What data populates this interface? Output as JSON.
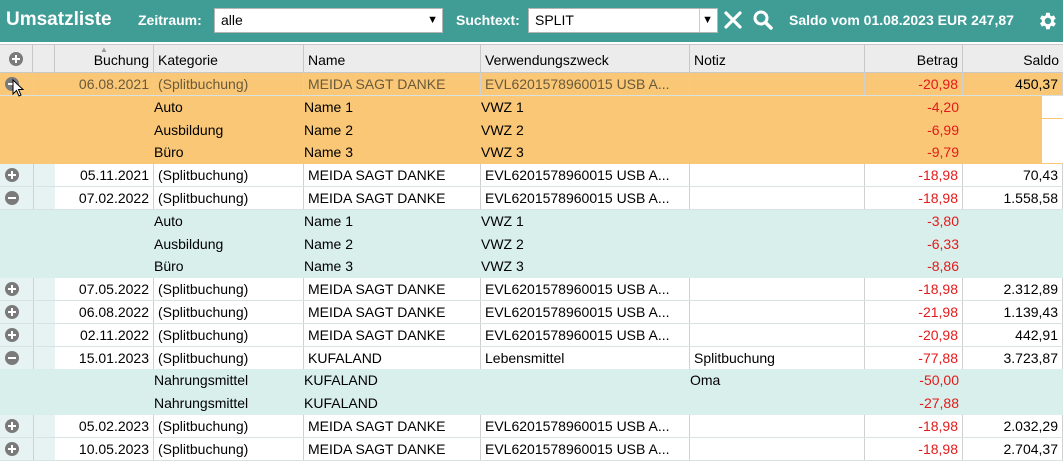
{
  "toolbar": {
    "title": "Umsatzliste",
    "zeitraum_label": "Zeitraum:",
    "zeitraum_value": "alle",
    "suchtext_label": "Suchtext:",
    "suchtext_value": "SPLIT",
    "saldo_text": "Saldo vom 01.08.2023 EUR 247,87",
    "icons": [
      "plus-circle-icon",
      "close-icon",
      "search-icon",
      "gear-icon"
    ]
  },
  "columns": {
    "buchung": "Buchung",
    "kategorie": "Kategorie",
    "name": "Name",
    "verwendungszweck": "Verwendungszweck",
    "notiz": "Notiz",
    "betrag": "Betrag",
    "saldo": "Saldo"
  },
  "colors": {
    "toolbar_bg": "#3f9d96",
    "selected_bg": "#f9c776",
    "row_bg": "#e6f3f2",
    "sub_bg": "#d9efec",
    "negative": "#e21a1a"
  },
  "rows": [
    {
      "kind": "main",
      "expanded": true,
      "selected": true,
      "date": "06.08.2021",
      "kategorie": "(Splitbuchung)",
      "name": "MEIDA SAGT DANKE",
      "vwz": "EVL6201578960015 USB A...",
      "notiz": "",
      "betrag": "-20,98",
      "saldo": "450,37"
    },
    {
      "kind": "sub",
      "selected": true,
      "kategorie": "Auto",
      "name": "Name 1",
      "vwz": "VWZ 1",
      "notiz": "",
      "betrag": "-4,20"
    },
    {
      "kind": "sub",
      "selected": true,
      "kategorie": "Ausbildung",
      "name": "Name 2",
      "vwz": "VWZ 2",
      "notiz": "",
      "betrag": "-6,99"
    },
    {
      "kind": "sub",
      "selected": true,
      "kategorie": "Büro",
      "name": "Name 3",
      "vwz": "VWZ 3",
      "notiz": "",
      "betrag": "-9,79"
    },
    {
      "kind": "main",
      "expanded": false,
      "date": "05.11.2021",
      "kategorie": "(Splitbuchung)",
      "name": "MEIDA SAGT DANKE",
      "vwz": "EVL6201578960015 USB A...",
      "notiz": "",
      "betrag": "-18,98",
      "saldo": "70,43"
    },
    {
      "kind": "main",
      "expanded": true,
      "date": "07.02.2022",
      "kategorie": "(Splitbuchung)",
      "name": "MEIDA SAGT DANKE",
      "vwz": "EVL6201578960015 USB A...",
      "notiz": "",
      "betrag": "-18,98",
      "saldo": "1.558,58"
    },
    {
      "kind": "sub",
      "kategorie": "Auto",
      "name": "Name 1",
      "vwz": "VWZ 1",
      "notiz": "",
      "betrag": "-3,80"
    },
    {
      "kind": "sub",
      "kategorie": "Ausbildung",
      "name": "Name 2",
      "vwz": "VWZ 2",
      "notiz": "",
      "betrag": "-6,33"
    },
    {
      "kind": "sub",
      "kategorie": "Büro",
      "name": "Name 3",
      "vwz": "VWZ 3",
      "notiz": "",
      "betrag": "-8,86"
    },
    {
      "kind": "main",
      "expanded": false,
      "date": "07.05.2022",
      "kategorie": "(Splitbuchung)",
      "name": "MEIDA SAGT DANKE",
      "vwz": "EVL6201578960015 USB A...",
      "notiz": "",
      "betrag": "-18,98",
      "saldo": "2.312,89"
    },
    {
      "kind": "main",
      "expanded": false,
      "date": "06.08.2022",
      "kategorie": "(Splitbuchung)",
      "name": "MEIDA SAGT DANKE",
      "vwz": "EVL6201578960015 USB A...",
      "notiz": "",
      "betrag": "-21,98",
      "saldo": "1.139,43"
    },
    {
      "kind": "main",
      "expanded": false,
      "date": "02.11.2022",
      "kategorie": "(Splitbuchung)",
      "name": "MEIDA SAGT DANKE",
      "vwz": "EVL6201578960015 USB A...",
      "notiz": "",
      "betrag": "-20,98",
      "saldo": "442,91"
    },
    {
      "kind": "main",
      "expanded": true,
      "date": "15.01.2023",
      "kategorie": "(Splitbuchung)",
      "name": "KUFALAND",
      "vwz": "Lebensmittel",
      "notiz": "Splitbuchung",
      "betrag": "-77,88",
      "saldo": "3.723,87"
    },
    {
      "kind": "sub",
      "kategorie": "Nahrungsmittel",
      "name": "KUFALAND",
      "vwz": "",
      "notiz": "Oma",
      "betrag": "-50,00"
    },
    {
      "kind": "sub",
      "kategorie": "Nahrungsmittel",
      "name": "KUFALAND",
      "vwz": "",
      "notiz": "",
      "betrag": "-27,88"
    },
    {
      "kind": "main",
      "expanded": false,
      "date": "05.02.2023",
      "kategorie": "(Splitbuchung)",
      "name": "MEIDA SAGT DANKE",
      "vwz": "EVL6201578960015 USB A...",
      "notiz": "",
      "betrag": "-18,98",
      "saldo": "2.032,29"
    },
    {
      "kind": "main",
      "expanded": false,
      "date": "10.05.2023",
      "kategorie": "(Splitbuchung)",
      "name": "MEIDA SAGT DANKE",
      "vwz": "EVL6201578960015 USB A...",
      "notiz": "",
      "betrag": "-18,98",
      "saldo": "2.704,37"
    }
  ]
}
